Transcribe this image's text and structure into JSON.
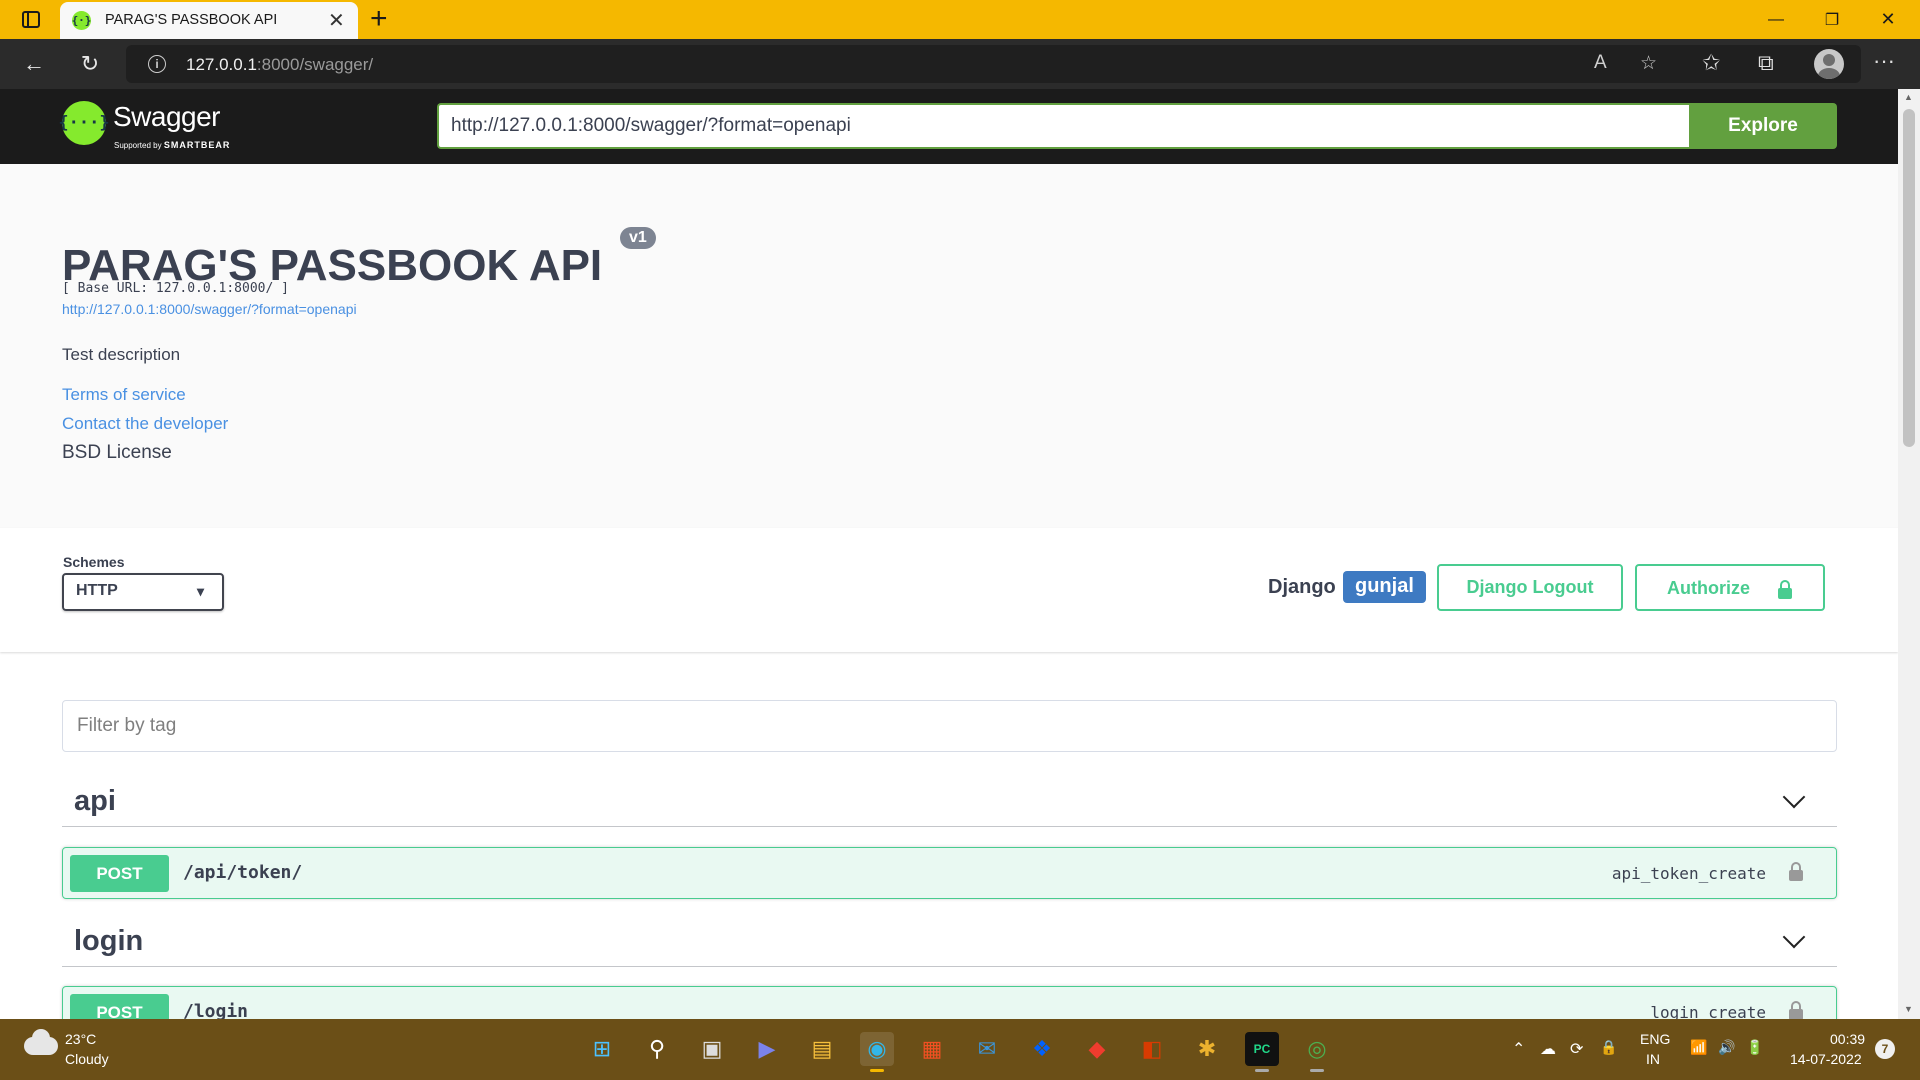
{
  "browser": {
    "tab_title": "PARAG'S PASSBOOK API",
    "tab_favicon": "{·}",
    "close": "✕",
    "new_tab": "+",
    "minimize": "—",
    "restore": "❐",
    "window_close": "✕",
    "back": "←",
    "reload": "↻",
    "address_host": "127.0.0.1",
    "address_path": ":8000/swagger/",
    "info": "i",
    "read_aloud": "A",
    "fav_add": "☆",
    "favorites": "✩",
    "collections": "⧉",
    "more": "···"
  },
  "swagger_topbar": {
    "brand": "Swagger",
    "tagline_prefix": "Supported by",
    "tagline_company": "SMARTBEAR",
    "logo_glyph": "{···}",
    "url_value": "http://127.0.0.1:8000/swagger/?format=openapi",
    "explore_label": "Explore"
  },
  "info": {
    "title": "PARAG'S PASSBOOK API",
    "version": "v1",
    "base_url": "[ Base URL: 127.0.0.1:8000/ ]",
    "spec_link": "http://127.0.0.1:8000/swagger/?format=openapi",
    "description": "Test description",
    "terms": "Terms of service",
    "contact": "Contact the developer",
    "license": "BSD License"
  },
  "schemes": {
    "label": "Schemes",
    "selected": "HTTP",
    "chevron": "▾"
  },
  "auth": {
    "django_label": "Django",
    "django_user": "gunjal",
    "logout_label": "Django Logout",
    "authorize_label": "Authorize"
  },
  "filter": {
    "placeholder": "Filter by tag"
  },
  "tags": [
    {
      "name": "api",
      "operations": [
        {
          "method": "POST",
          "path": "/api/token/",
          "operation_id": "api_token_create"
        }
      ]
    },
    {
      "name": "login",
      "operations": [
        {
          "method": "POST",
          "path": "/login",
          "operation_id": "login_create"
        }
      ]
    }
  ],
  "scrollbar": {
    "up": "▲",
    "down": "▼"
  },
  "taskbar": {
    "weather_temp": "23°C",
    "weather_desc": "Cloudy",
    "apps": [
      "windows-icon",
      "search-icon",
      "task-view-icon",
      "teams-icon",
      "file-explorer-icon",
      "edge-icon",
      "store-icon",
      "mail-icon",
      "dropbox-icon",
      "git-icon",
      "office-icon",
      "slack-icon",
      "pycharm-icon",
      "chrome-icon"
    ],
    "app_glyphs": [
      "⊞",
      "⚲",
      "▣",
      "▶",
      "▤",
      "◉",
      "▦",
      "✉",
      "❖",
      "◆",
      "◧",
      "✱",
      "PC",
      "◎"
    ],
    "tray_chevron": "⌃",
    "tray_glyphs": [
      "☁",
      "⟳",
      "🔒",
      "📶",
      "🔊",
      "🔋"
    ],
    "lang_top": "ENG",
    "lang_bottom": "IN",
    "time": "00:39",
    "date": "14-07-2022",
    "notifications": "7"
  }
}
